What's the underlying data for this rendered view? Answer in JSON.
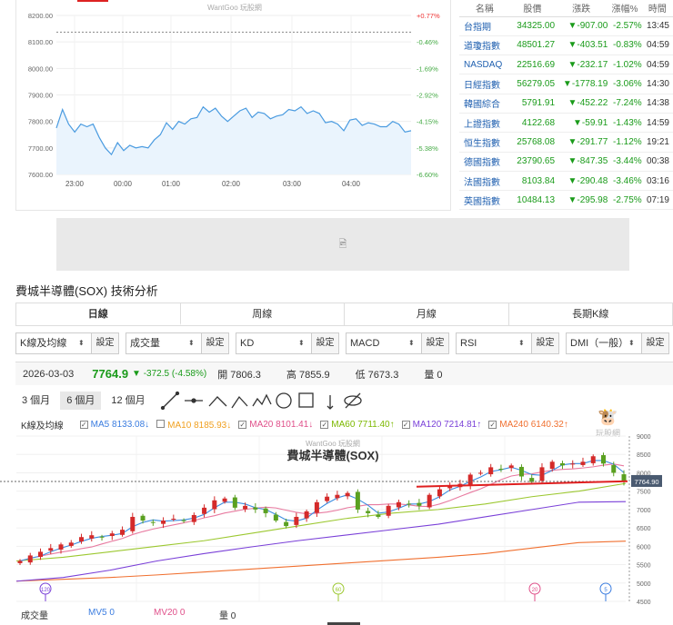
{
  "intraday": {
    "watermark": "WantGoo 玩股網",
    "yticks": [
      "8200.00",
      "8100.00",
      "8000.00",
      "7900.00",
      "7800.00",
      "7700.00",
      "7600.00"
    ],
    "pct": [
      "+0.77%",
      "-0.46%",
      "-1.69%",
      "-2.92%",
      "-4.15%",
      "-5.38%",
      "-6.60%"
    ],
    "xticks": [
      "23:00",
      "00:00",
      "01:00",
      "02:00",
      "03:00",
      "04:00"
    ]
  },
  "chart_data": [
    {
      "type": "line",
      "title": "WantGoo 玩股網",
      "ylim": [
        7600,
        8200
      ],
      "prev_close": 8137,
      "values": [
        7775,
        7845,
        7790,
        7760,
        7790,
        7780,
        7790,
        7740,
        7700,
        7675,
        7720,
        7690,
        7710,
        7700,
        7705,
        7700,
        7730,
        7750,
        7795,
        7770,
        7800,
        7790,
        7810,
        7815,
        7855,
        7835,
        7850,
        7820,
        7800,
        7820,
        7840,
        7850,
        7815,
        7835,
        7830,
        7810,
        7820,
        7825,
        7845,
        7840,
        7855,
        7830,
        7840,
        7830,
        7795,
        7800,
        7790,
        7765,
        7805,
        7810,
        7785,
        7795,
        7790,
        7780,
        7780,
        7800,
        7790,
        7760,
        7765
      ]
    },
    {
      "type": "candlestick",
      "title": "費城半導體(SOX)",
      "ylim": [
        4500,
        9000
      ],
      "yticks": [
        "9000",
        "8500",
        "8000",
        "7500",
        "7000",
        "6500",
        "6000",
        "5500",
        "5000",
        "4500"
      ],
      "last_label": "7764.90",
      "closes": [
        5600,
        5750,
        5850,
        5950,
        6050,
        6100,
        6250,
        6300,
        6250,
        6350,
        6450,
        6800,
        6700,
        6650,
        6700,
        6750,
        6700,
        6850,
        7050,
        7250,
        7300,
        7050,
        7100,
        7000,
        6900,
        6700,
        6550,
        6800,
        6950,
        7200,
        7350,
        7400,
        7450,
        7000,
        6900,
        6800,
        7100,
        7200,
        7150,
        7100,
        7400,
        7550,
        7650,
        7700,
        7950,
        8000,
        8150,
        8100,
        8200,
        7900,
        7750,
        8150,
        8300,
        8200,
        8250,
        8300,
        8450,
        8250,
        8000,
        7765
      ],
      "ma60": [
        5600,
        5700,
        5850,
        6000,
        6150,
        6350,
        6550,
        6750,
        6900,
        7000,
        7150,
        7350,
        7500,
        7711
      ],
      "ma120": [
        5050,
        5150,
        5350,
        5600,
        5800,
        5980,
        6150,
        6300,
        6450,
        6600,
        6800,
        7000,
        7200,
        7215
      ],
      "ma240": [
        5050,
        5100,
        5150,
        5220,
        5300,
        5380,
        5460,
        5540,
        5620,
        5700,
        5800,
        5950,
        6100,
        6140
      ],
      "support": 7770,
      "markers": [
        "120",
        "60",
        "20",
        "5"
      ]
    }
  ],
  "quotes": {
    "headers": [
      "名稱",
      "股價",
      "漲跌",
      "漲幅%",
      "時間"
    ],
    "rows": [
      [
        "台指期",
        "34325.00",
        "▼-907.00",
        "-2.57%",
        "13:45"
      ],
      [
        "道瓊指數",
        "48501.27",
        "▼-403.51",
        "-0.83%",
        "04:59"
      ],
      [
        "NASDAQ",
        "22516.69",
        "▼-232.17",
        "-1.02%",
        "04:59"
      ],
      [
        "日經指數",
        "56279.05",
        "▼-1778.19",
        "-3.06%",
        "14:30"
      ],
      [
        "韓國綜合",
        "5791.91",
        "▼-452.22",
        "-7.24%",
        "14:38"
      ],
      [
        "上證指數",
        "4122.68",
        "▼-59.91",
        "-1.43%",
        "14:59"
      ],
      [
        "恒生指數",
        "25768.08",
        "▼-291.77",
        "-1.12%",
        "19:21"
      ],
      [
        "德國指數",
        "23790.65",
        "▼-847.35",
        "-3.44%",
        "00:38"
      ],
      [
        "法國指數",
        "8103.84",
        "▼-290.48",
        "-3.46%",
        "03:16"
      ],
      [
        "英國指數",
        "10484.13",
        "▼-295.98",
        "-2.75%",
        "07:19"
      ]
    ]
  },
  "section_title": "費城半導體(SOX) 技術分析",
  "tabs": [
    "日線",
    "周線",
    "月線",
    "長期K線"
  ],
  "selects": [
    {
      "value": "K線及均線",
      "btn": "設定"
    },
    {
      "value": "成交量",
      "btn": "設定"
    },
    {
      "value": "KD",
      "btn": "設定"
    },
    {
      "value": "MACD",
      "btn": "設定"
    },
    {
      "value": "RSI",
      "btn": "設定"
    },
    {
      "value": "DMI（一般）",
      "btn": "設定"
    }
  ],
  "quote": {
    "date": "2026-03-03",
    "price": "7764.9",
    "change": "▼ -372.5 (-4.58%)",
    "open": "開 7806.3",
    "high": "高 7855.9",
    "low": "低 7673.3",
    "volume": "量 0"
  },
  "ranges": [
    "3 個月",
    "6 個月",
    "12 個月"
  ],
  "ma_legend": {
    "label": "K線及均線",
    "items": [
      {
        "text": "MA5 8133.08↓",
        "color": "#3b7de0",
        "checked": true
      },
      {
        "text": "MA10 8185.93↓",
        "color": "#f0a020",
        "checked": false
      },
      {
        "text": "MA20 8101.41↓",
        "color": "#e0508a",
        "checked": true
      },
      {
        "text": "MA60 7711.40↑",
        "color": "#7cb800",
        "checked": true
      },
      {
        "text": "MA120 7214.81↑",
        "color": "#7a40d8",
        "checked": true
      },
      {
        "text": "MA240 6140.32↑",
        "color": "#f07030",
        "checked": true
      }
    ]
  },
  "volume": {
    "label": "成交量",
    "mv5": "MV5 0",
    "mv20": "MV20 0",
    "vol": "量 0"
  },
  "logo_text": "玩股網"
}
